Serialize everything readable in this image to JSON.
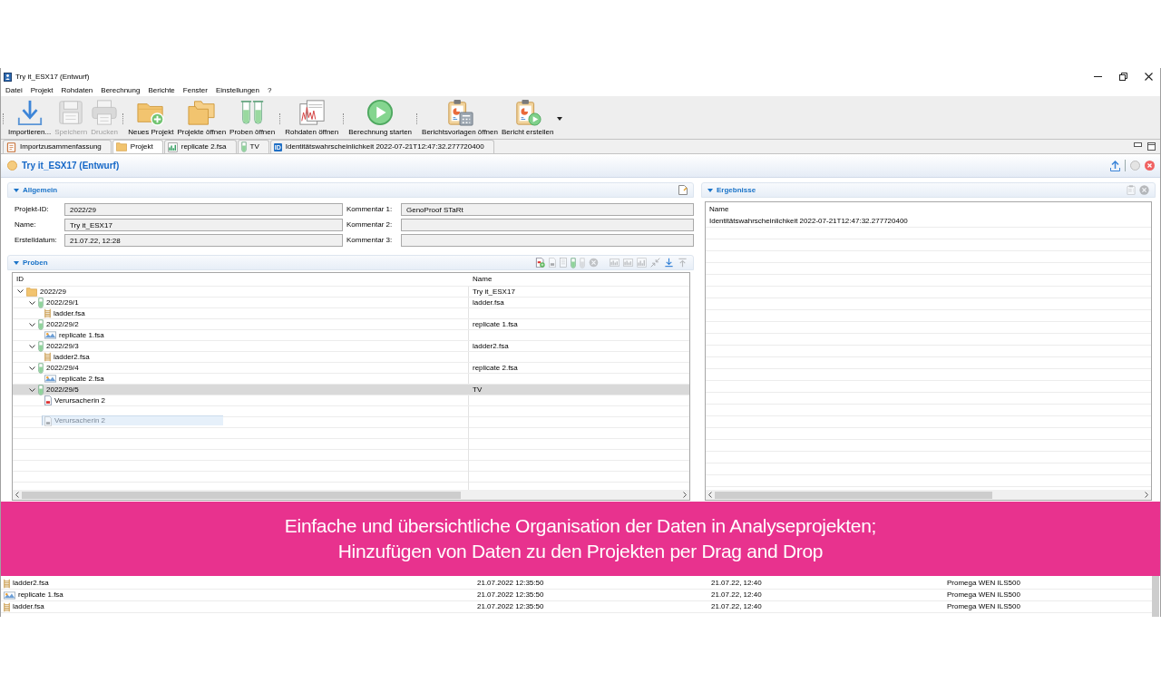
{
  "window": {
    "title": "Try it_ESX17 (Entwurf)"
  },
  "menu": [
    "Datei",
    "Projekt",
    "Rohdaten",
    "Berechnung",
    "Berichte",
    "Fenster",
    "Einstellungen",
    "?"
  ],
  "toolbar_groups": [
    {
      "items": [
        {
          "label": "Importieren...",
          "kind": "import",
          "disabled": false
        },
        {
          "label": "Speichern",
          "kind": "save",
          "disabled": true
        },
        {
          "label": "Drucken",
          "kind": "print",
          "disabled": true
        }
      ]
    },
    {
      "items": [
        {
          "label": "Neues Projekt",
          "kind": "new-project",
          "disabled": false
        },
        {
          "label": "Projekte öffnen",
          "kind": "open-projects",
          "disabled": false
        },
        {
          "label": "Proben öffnen",
          "kind": "open-samples",
          "disabled": false
        }
      ]
    },
    {
      "items": [
        {
          "label": "Rohdaten öffnen",
          "kind": "open-raw-data",
          "disabled": false
        }
      ]
    },
    {
      "items": [
        {
          "label": "Berechnung starten",
          "kind": "start",
          "disabled": false
        }
      ]
    },
    {
      "items": [
        {
          "label": "Berichtsvorlagen öffnen",
          "kind": "report-templates",
          "disabled": false
        },
        {
          "label": "Bericht erstellen",
          "kind": "create-report",
          "disabled": false
        }
      ]
    }
  ],
  "editor_tabs": [
    {
      "label": "Importzusammenfassung",
      "kind": "report",
      "selected": false
    },
    {
      "label": "Projekt",
      "kind": "folder",
      "selected": true
    },
    {
      "label": "replicate 2.fsa",
      "kind": "chart",
      "selected": false
    },
    {
      "label": "TV",
      "kind": "sample",
      "selected": false
    },
    {
      "label": "Identitätswahrscheinlichkeit 2022-07-21T12:47:32.277720400",
      "kind": "id",
      "badge": "ID",
      "selected": false
    }
  ],
  "editor": {
    "title": "Try it_ESX17 (Entwurf)"
  },
  "general": {
    "title": "Allgemein",
    "fields": [
      {
        "label": "Projekt-ID:",
        "value": "2022/29"
      },
      {
        "label": "Name:",
        "value": "Try it_ESX17"
      },
      {
        "label": "Erstelldatum:",
        "value": "21.07.22, 12:28"
      }
    ],
    "comments": [
      {
        "label": "Kommentar 1:",
        "value": "GenoProof STaRt"
      },
      {
        "label": "Kommentar 2:"
      },
      {
        "label": "Kommentar 3:"
      }
    ]
  },
  "samples": {
    "title": "Proben",
    "tools": [
      {
        "kind": "add-sample",
        "disabled": false
      },
      {
        "kind": "document",
        "disabled": true
      },
      {
        "kind": "page",
        "disabled": true
      },
      {
        "kind": "sample",
        "disabled": false
      },
      {
        "kind": "sample",
        "disabled": true
      },
      {
        "kind": "remove",
        "disabled": true
      },
      {
        "kind": "bars",
        "disabled": true
      },
      {
        "kind": "bars",
        "disabled": true
      },
      {
        "kind": "chart",
        "disabled": true
      },
      {
        "kind": "collapse",
        "disabled": true
      },
      {
        "kind": "download",
        "disabled": false
      },
      {
        "kind": "upload",
        "disabled": true
      }
    ],
    "columns": [
      "ID",
      "Name"
    ],
    "tree": [
      {
        "label": "2022/29",
        "name": "Try it_ESX17",
        "kind": "folder",
        "expanded": true,
        "selected": false,
        "children": [
          {
            "label": "2022/29/1",
            "name": "ladder.fsa",
            "kind": "sample",
            "expanded": true,
            "selected": false,
            "children": [
              {
                "label": "ladder.fsa",
                "kind": "ladder",
                "selected": false
              }
            ]
          },
          {
            "label": "2022/29/2",
            "name": "replicate 1.fsa",
            "kind": "sample",
            "expanded": true,
            "selected": false,
            "children": [
              {
                "label": "replicate 1.fsa",
                "kind": "image",
                "selected": false
              }
            ]
          },
          {
            "label": "2022/29/3",
            "name": "ladder2.fsa",
            "kind": "sample",
            "expanded": true,
            "selected": false,
            "children": [
              {
                "label": "ladder2.fsa",
                "kind": "ladder",
                "selected": false
              }
            ]
          },
          {
            "label": "2022/29/4",
            "name": "replicate 2.fsa",
            "kind": "sample",
            "expanded": true,
            "selected": false,
            "children": [
              {
                "label": "replicate 2.fsa",
                "kind": "image",
                "selected": false
              }
            ]
          },
          {
            "label": "2022/29/5",
            "name": "TV",
            "kind": "sample",
            "expanded": true,
            "selected": true,
            "children": [
              {
                "label": "Verursacherin 2",
                "kind": "document",
                "selected": false
              }
            ]
          }
        ]
      }
    ],
    "drag_preview": {
      "label": "Verursacherin 2",
      "kind": "document"
    }
  },
  "results": {
    "title": "Ergebnisse",
    "tools": [
      {
        "kind": "clipboard",
        "disabled": true
      },
      {
        "kind": "close",
        "disabled": true
      }
    ],
    "columns": [
      "Name"
    ],
    "rows": [
      {
        "name": "Identitätswahrscheinlichkeit 2022-07-21T12:47:32.277720400",
        "selected": false
      }
    ]
  },
  "caption": {
    "lines": [
      "Einfache und übersichtliche Organisation der Daten in Analyseprojekten;",
      "Hinzufügen von Daten zu den Projekten per Drag and Drop"
    ]
  },
  "raw_data": {
    "rows": [
      {
        "name": "ladder2.fsa",
        "kind": "ladder",
        "selected": false,
        "cells": [
          "21.07.2022 12:35:50",
          "21.07.22, 12:40",
          "Promega WEN ILS500"
        ]
      },
      {
        "name": "replicate 1.fsa",
        "kind": "image",
        "selected": false,
        "cells": [
          "21.07.2022 12:35:50",
          "21.07.22, 12:40",
          "Promega WEN ILS500"
        ]
      },
      {
        "name": "ladder.fsa",
        "kind": "ladder",
        "selected": false,
        "cells": [
          "21.07.2022 12:35:50",
          "21.07.22, 12:40",
          "Promega WEN ILS500"
        ]
      }
    ]
  }
}
